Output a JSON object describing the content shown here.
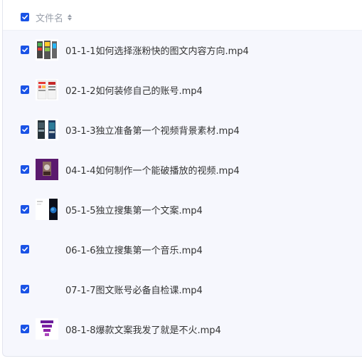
{
  "header": {
    "column_label": "文件名"
  },
  "files": [
    {
      "name": "01-1-1如何选择涨粉快的图文内容方向.mp4",
      "checked": true,
      "thumb": "thumb-phone-screens-icon"
    },
    {
      "name": "02-1-2如何装修自己的账号.mp4",
      "checked": true,
      "thumb": "thumb-profile-page-icon"
    },
    {
      "name": "03-1-3独立准备第一个视频背景素材.mp4",
      "checked": true,
      "thumb": "thumb-video-editor-icon"
    },
    {
      "name": "04-1-4如何制作一个能破播放的视频.mp4",
      "checked": true,
      "thumb": "thumb-purple-video-icon"
    },
    {
      "name": "05-1-5独立搜集第一个文案.mp4",
      "checked": true,
      "thumb": "thumb-earth-phone-icon"
    },
    {
      "name": "06-1-6独立搜集第一个音乐.mp4",
      "checked": true,
      "thumb": ""
    },
    {
      "name": "07-1-7图文账号必备自检课.mp4",
      "checked": true,
      "thumb": ""
    },
    {
      "name": "08-1-8爆款文案我发了就是不火.mp4",
      "checked": true,
      "thumb": "thumb-funnel-icon"
    }
  ],
  "colors": {
    "checkbox": "#1a53e6",
    "panel_bg": "#f6f7fd",
    "header_text": "#9aa0ab"
  }
}
